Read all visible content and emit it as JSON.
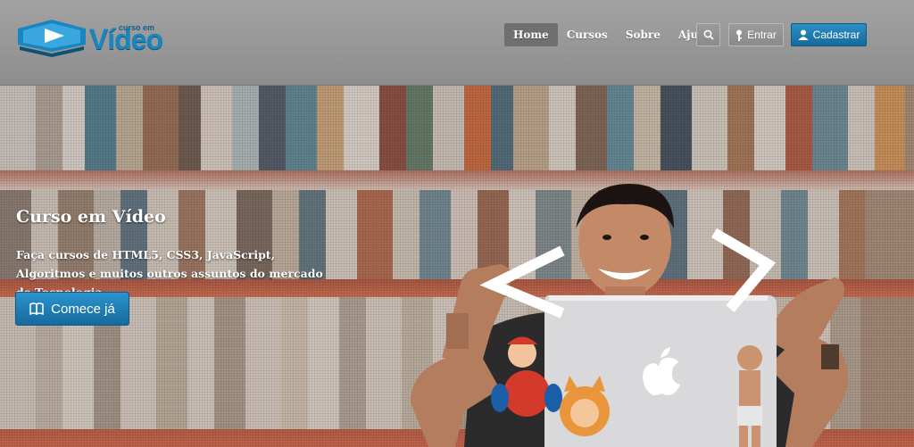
{
  "header": {
    "logo": {
      "small_text": "curso em",
      "big_text": "Vídeo"
    },
    "nav": [
      {
        "label": "Home",
        "active": true
      },
      {
        "label": "Cursos",
        "active": false
      },
      {
        "label": "Sobre",
        "active": false
      },
      {
        "label": "Ajuda",
        "active": false
      }
    ],
    "search_icon": "search-icon",
    "login_label": "Entrar",
    "signup_label": "Cadastrar"
  },
  "hero": {
    "title": "Curso em Vídeo",
    "text": "Faça cursos de HTML5, CSS3, JavaScript, Algoritmos e muitos outros assuntos do mercado de Tecnologia.",
    "cta_label": "Comece já"
  },
  "colors": {
    "accent": "#1f7fb6",
    "header_bg": "#9a9a9a",
    "shelf_red": "#c14a2f"
  }
}
